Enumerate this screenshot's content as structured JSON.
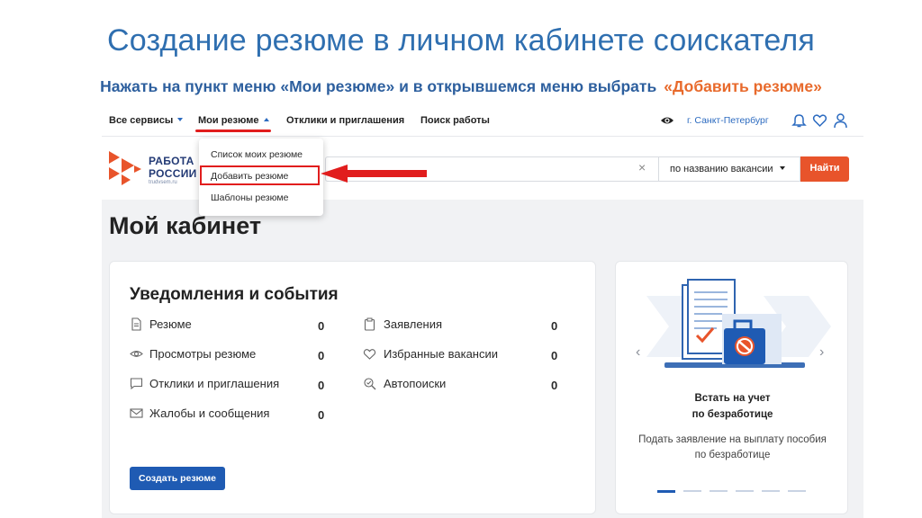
{
  "slide": {
    "title": "Создание резюме в личном кабинете соискателя",
    "subtitle": "Нажать на пункт меню «Мои резюме» и в открывшемся меню выбрать",
    "subtitle_highlight": "«Добавить резюме»",
    "highlight_color": "#e86a2c",
    "title_color": "#2f6fb0"
  },
  "topnav": {
    "all_services": "Все сервисы",
    "my_resumes": "Мои резюме",
    "responses": "Отклики и приглашения",
    "job_search": "Поиск работы",
    "city": "г. Санкт-Петербург",
    "icons": [
      "eye-icon",
      "bell-icon",
      "heart-icon",
      "user-icon"
    ]
  },
  "logo": {
    "line1": "РАБОТА",
    "line2": "РОССИИ",
    "site": "trudvsem.ru"
  },
  "search": {
    "clear": "×",
    "mode": "по названию вакансии",
    "button": "Найти",
    "button_color": "#e8542b"
  },
  "dropdown": {
    "items": [
      "Список моих резюме",
      "Добавить резюме",
      "Шаблоны резюме"
    ],
    "highlighted_index": 1
  },
  "page": {
    "title": "Мой кабинет"
  },
  "notifications": {
    "title": "Уведомления и события",
    "left": [
      {
        "label": "Резюме",
        "value": "0",
        "icon": "document-icon"
      },
      {
        "label": "Просмотры резюме",
        "value": "0",
        "icon": "eye-icon"
      },
      {
        "label": "Отклики и приглашения",
        "value": "0",
        "icon": "chat-icon"
      },
      {
        "label": "Жалобы и сообщения",
        "value": "0",
        "icon": "mail-icon"
      }
    ],
    "right": [
      {
        "label": "Заявления",
        "value": "0",
        "icon": "clipboard-icon"
      },
      {
        "label": "Избранные вакансии",
        "value": "0",
        "icon": "heart-icon"
      },
      {
        "label": "Автопоиски",
        "value": "0",
        "icon": "autosearch-icon"
      }
    ],
    "create_button": "Создать резюме",
    "button_color": "#1f5bb3"
  },
  "promo": {
    "title_line1": "Встать на учет",
    "title_line2": "по безработице",
    "desc_line1": "Подать заявление на выплату пособия",
    "desc_line2": "по безработице",
    "prev": "‹",
    "next": "›",
    "slides_total": 6,
    "active_slide": 1
  }
}
